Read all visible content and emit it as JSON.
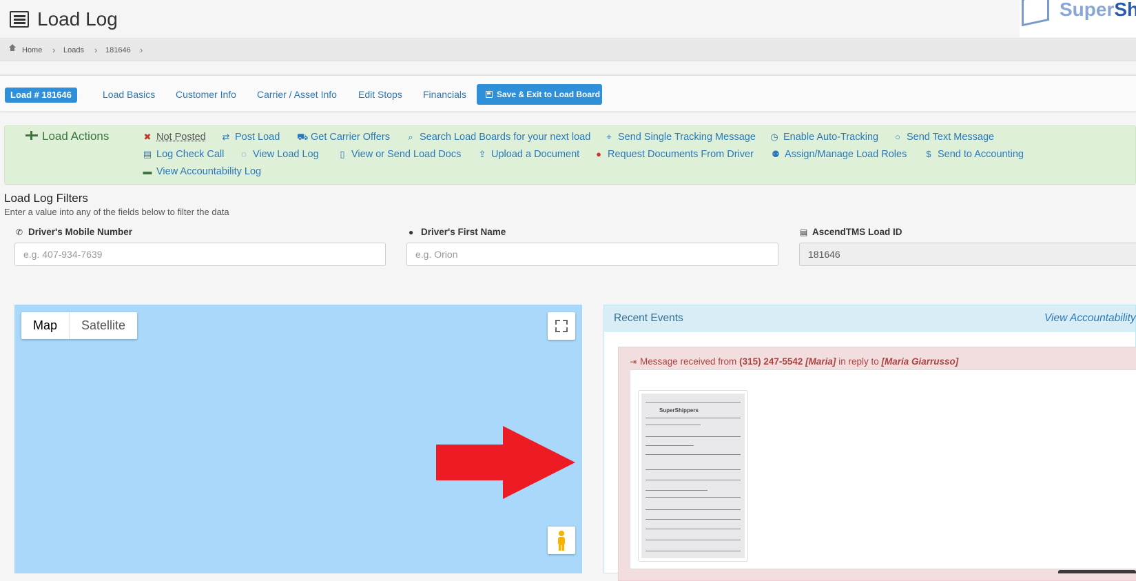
{
  "header": {
    "title": "Load Log",
    "logo_text_a": "Super",
    "logo_text_b": "Sh"
  },
  "breadcrumb": {
    "items": [
      "Home",
      "Loads",
      "181646"
    ]
  },
  "tabs": {
    "badge": "Load # 181646",
    "links": [
      "Load Basics",
      "Customer Info",
      "Carrier / Asset Info",
      "Edit Stops",
      "Financials"
    ],
    "save_label": "Save & Exit to Load Board"
  },
  "actions": {
    "title": "Load Actions",
    "not_posted": "Not Posted",
    "items": [
      {
        "icon": "retweet-icon",
        "label": "Post Load"
      },
      {
        "icon": "truck-icon",
        "label": "Get Carrier Offers"
      },
      {
        "icon": "search-icon",
        "label": "Search Load Boards for your next load"
      },
      {
        "icon": "crosshair-icon",
        "label": "Send Single Tracking Message"
      },
      {
        "icon": "clock-icon",
        "label": "Enable Auto-Tracking"
      },
      {
        "icon": "comment-icon",
        "label": "Send Text Message"
      },
      {
        "icon": "clipboard-icon",
        "label": "Log Check Call"
      },
      {
        "icon": "comments-icon",
        "label": "View Load Log"
      },
      {
        "icon": "file-icon",
        "label": "View or Send Load Docs"
      },
      {
        "icon": "upload-icon",
        "label": "Upload a Document"
      },
      {
        "icon": "user-icon",
        "label": "Request Documents From Driver"
      },
      {
        "icon": "users-icon",
        "label": "Assign/Manage Load Roles"
      },
      {
        "icon": "dollar-icon",
        "label": "Send to Accounting"
      },
      {
        "icon": "briefcase-icon",
        "label": "View Accountability Log"
      }
    ]
  },
  "filters": {
    "title": "Load Log Filters",
    "subtitle": "Enter a value into any of the fields below to filter the data",
    "mobile_label": "Driver's Mobile Number",
    "mobile_placeholder": "e.g. 407-934-7639",
    "first_name_label": "Driver's First Name",
    "first_name_placeholder": "e.g. Orion",
    "load_id_label": "AscendTMS Load ID",
    "load_id_value": "181646"
  },
  "map": {
    "map_label": "Map",
    "satellite_label": "Satellite"
  },
  "events": {
    "title": "Recent Events",
    "link": "View Accountability",
    "msg_prefix": "Message received from",
    "phone": "(315) 247-5542",
    "sender": "[Maria]",
    "msg_mid": "in reply to",
    "recipient": "[Maria Giarrusso]",
    "doc_brand": "SuperShippers"
  },
  "colors": {
    "primary": "#2f8fd8",
    "link": "#2a77b8",
    "success_bg": "#dff0d8",
    "info_bg": "#d9edf7",
    "danger_bg": "#f2dede",
    "map_water": "#a9d8fb",
    "arrow": "#ed1c24"
  }
}
